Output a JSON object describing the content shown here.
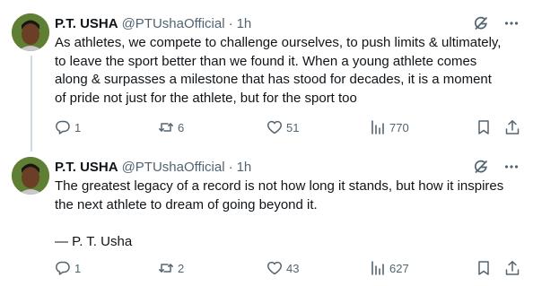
{
  "tweets": [
    {
      "author_name": "P.T. USHA",
      "handle": "@PTUshaOfficial",
      "separator": "·",
      "time": "1h",
      "text": "As athletes, we compete to challenge ourselves, to push limits & ultimately,\nto leave the sport better than we found it. When a young athlete comes\nalong  & surpasses a milestone that has stood for decades, it is a moment\nof pride not just for the athlete, but for the sport too",
      "replies": "1",
      "reposts": "6",
      "likes": "51",
      "views": "770"
    },
    {
      "author_name": "P.T. USHA",
      "handle": "@PTUshaOfficial",
      "separator": "·",
      "time": "1h",
      "text": "The greatest legacy of a record is not how long it stands, but how it inspires\nthe next athlete to dream of going beyond it.\n\n— P. T. Usha",
      "replies": "1",
      "reposts": "2",
      "likes": "43",
      "views": "627"
    }
  ],
  "icons": {
    "grok": "grok-icon",
    "more": "more-icon",
    "reply": "reply-icon",
    "retweet": "retweet-icon",
    "like": "like-icon",
    "views": "views-icon",
    "bookmark": "bookmark-icon",
    "share": "share-icon"
  },
  "colors": {
    "text": "#0f1419",
    "secondary": "#536471",
    "thread_line": "#cfd9de"
  }
}
